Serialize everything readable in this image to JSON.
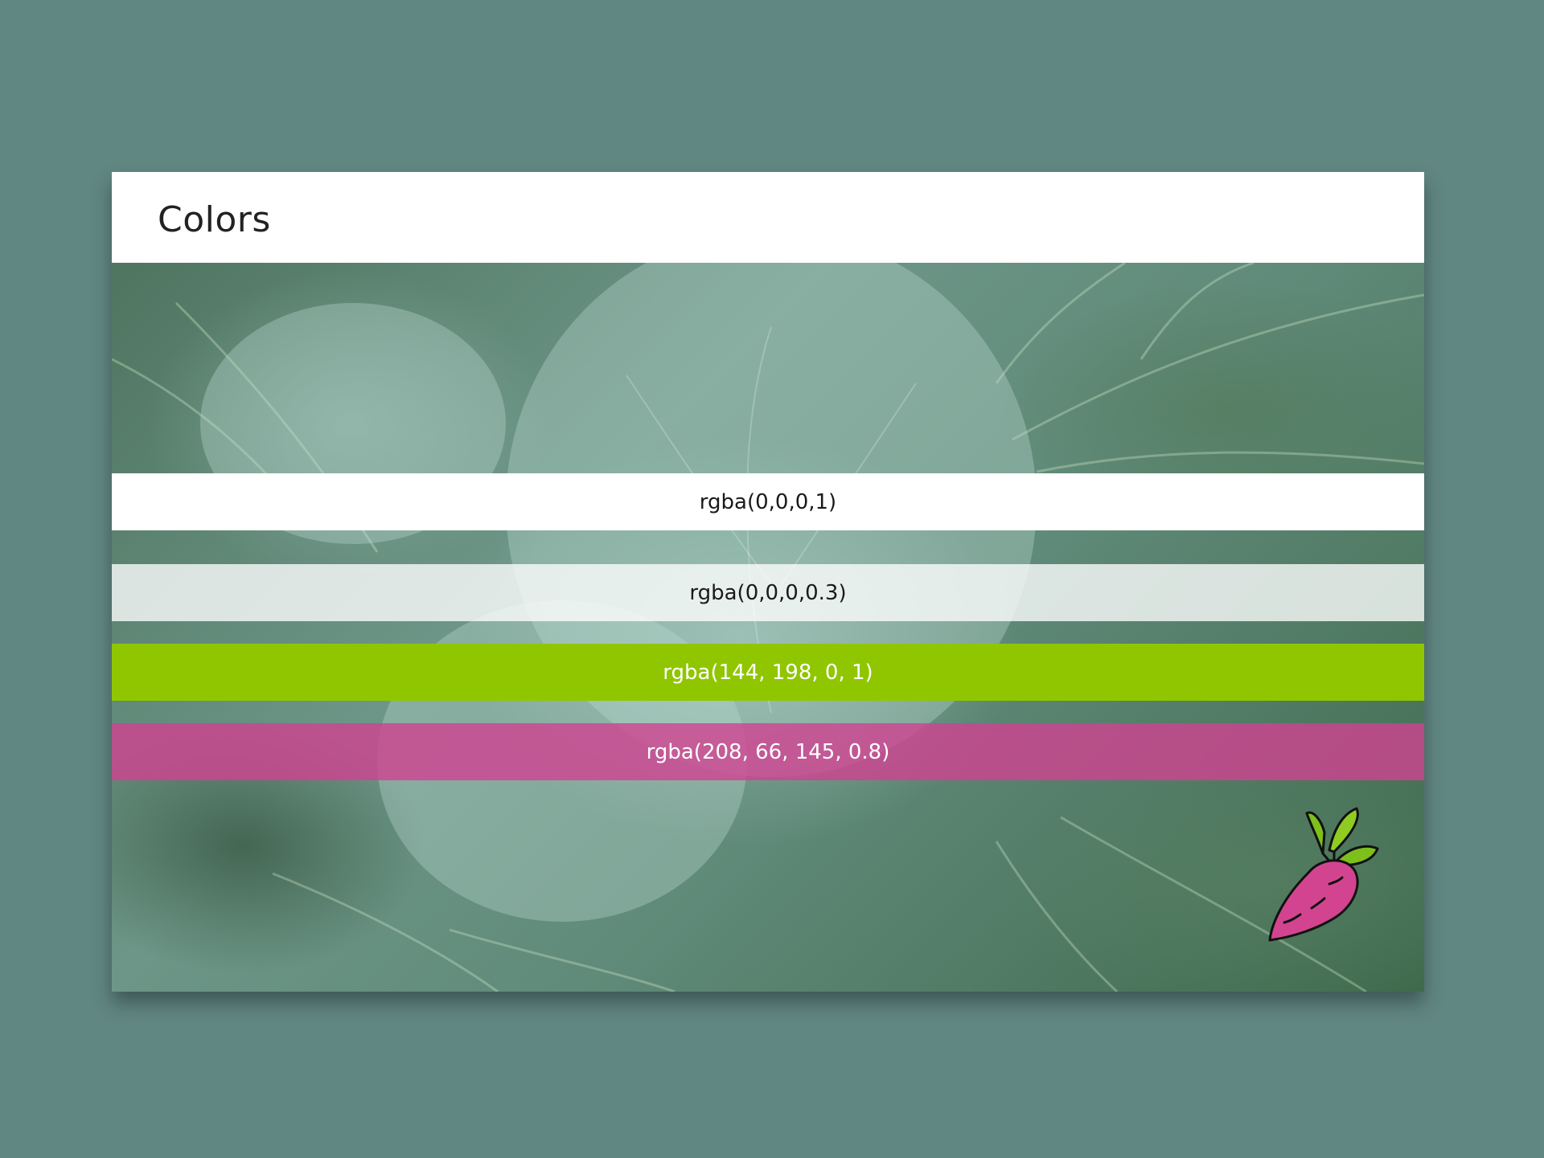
{
  "card": {
    "title": "Colors"
  },
  "swatches": [
    {
      "label": "rgba(0,0,0,1)",
      "background": "#ffffff",
      "text_color": "#1a1a1a"
    },
    {
      "label": "rgba(0,0,0,0.3)",
      "background": "rgba(255,255,255,0.78)",
      "text_color": "#1a1a1a"
    },
    {
      "label": "rgba(144, 198, 0, 1)",
      "background": "#90c600",
      "text_color": "#ffffff"
    },
    {
      "label": "rgba(208, 66, 145, 0.8)",
      "background": "rgba(208,66,145,0.8)",
      "text_color": "#ffffff"
    }
  ],
  "background_image": "cabbage-photo",
  "logo_icon": "beet-icon"
}
